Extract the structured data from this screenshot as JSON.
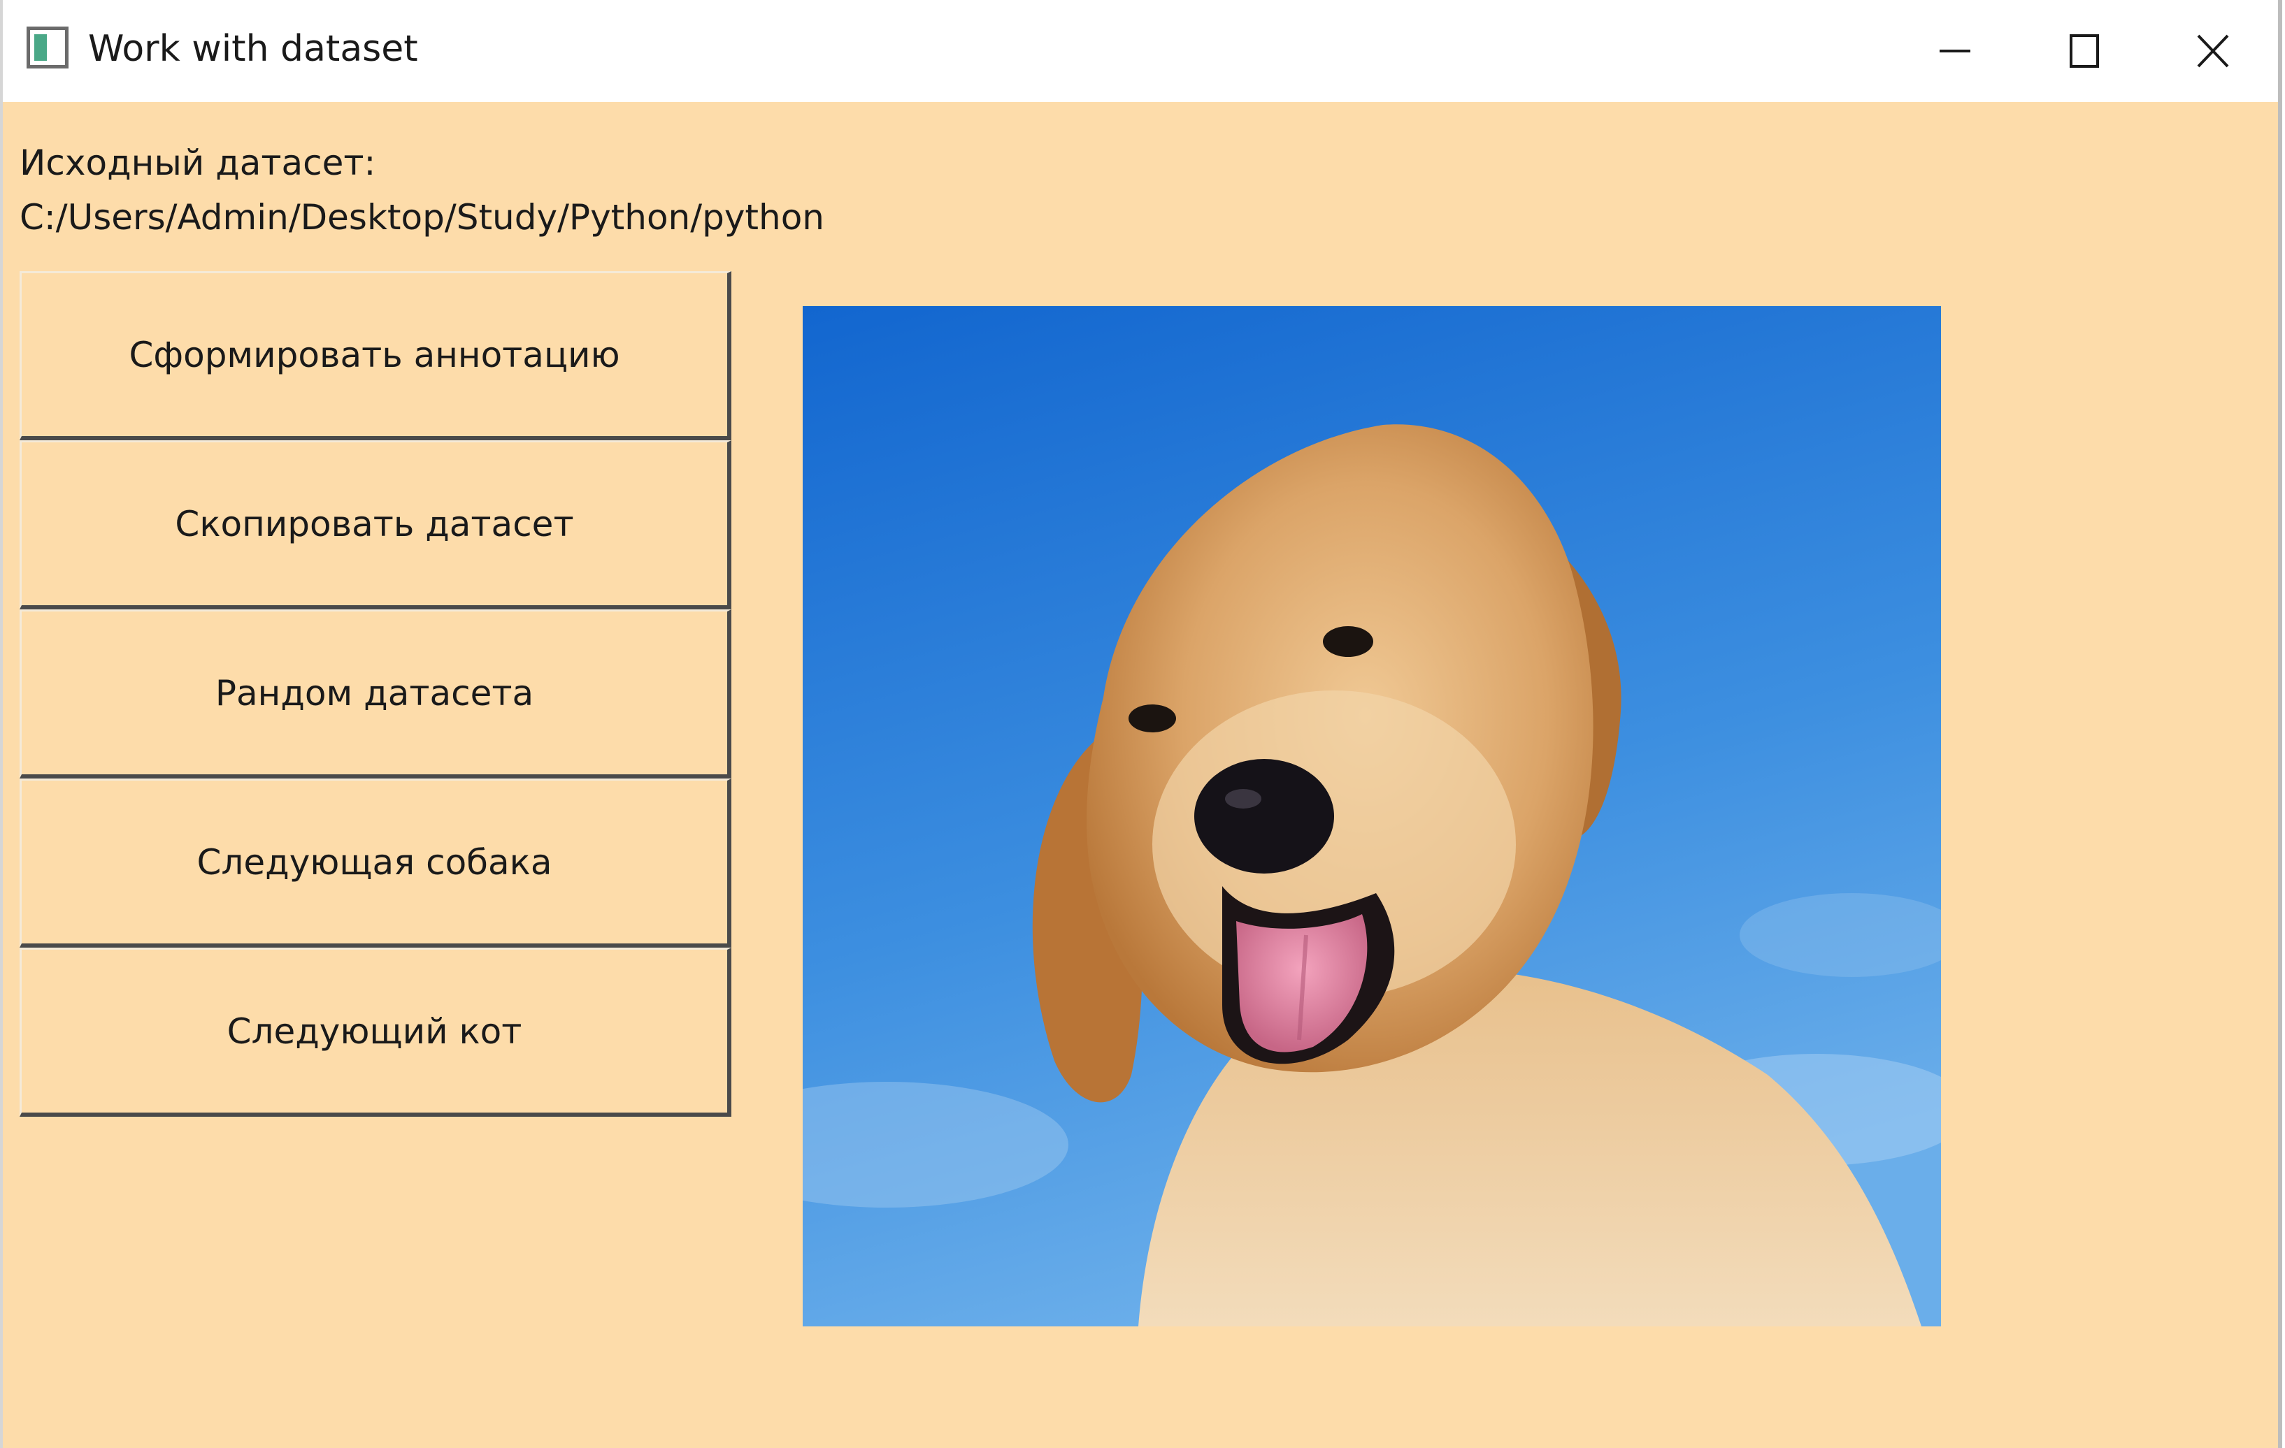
{
  "window": {
    "title": "Work with dataset",
    "background_color": "#fddcaa",
    "controls": {
      "minimize_icon": "minimize-icon",
      "maximize_icon": "maximize-icon",
      "close_icon": "close-icon"
    }
  },
  "dataset": {
    "heading": "Исходный датасет:",
    "path": "C:/Users/Admin/Desktop/Study/Python/python"
  },
  "buttons": [
    {
      "label": "Сформировать аннотацию"
    },
    {
      "label": "Скопировать датасет"
    },
    {
      "label": "Рандом датасета"
    },
    {
      "label": "Следующая собака"
    },
    {
      "label": "Следующий кот"
    }
  ],
  "image": {
    "subject": "dog-photo",
    "sky_color": "#2f7fd6",
    "fur_color": "#d9a463"
  }
}
